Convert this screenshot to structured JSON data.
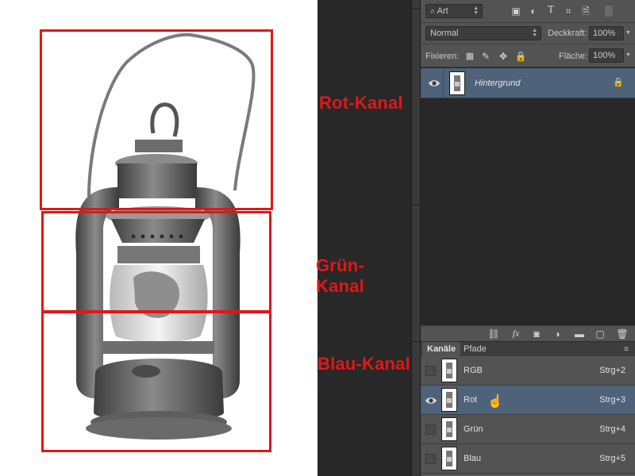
{
  "canvas": {
    "labels": {
      "rot": "Rot-Kanal",
      "gruen": "Grün-Kanal",
      "blau": "Blau-Kanal"
    },
    "label_color": "#e11717"
  },
  "layers_panel": {
    "filter": {
      "kind": "Art"
    },
    "blend": {
      "mode": "Normal",
      "opacity_label": "Deckkraft:",
      "opacity_value": "100%"
    },
    "lock": {
      "label": "Fixieren:",
      "fill_label": "Fläche:",
      "fill_value": "100%"
    },
    "layers": [
      {
        "name": "Hintergrund",
        "visible": true,
        "locked": true
      }
    ],
    "selection_color": "#4e627a"
  },
  "channels_panel": {
    "tabs": [
      "Kanäle",
      "Pfade"
    ],
    "channels": [
      {
        "name": "RGB",
        "shortcut": "Strg+2",
        "visible": false,
        "selected": false
      },
      {
        "name": "Rot",
        "shortcut": "Strg+3",
        "visible": true,
        "selected": true
      },
      {
        "name": "Grün",
        "shortcut": "Strg+4",
        "visible": false,
        "selected": false
      },
      {
        "name": "Blau",
        "shortcut": "Strg+5",
        "visible": false,
        "selected": false
      }
    ]
  }
}
